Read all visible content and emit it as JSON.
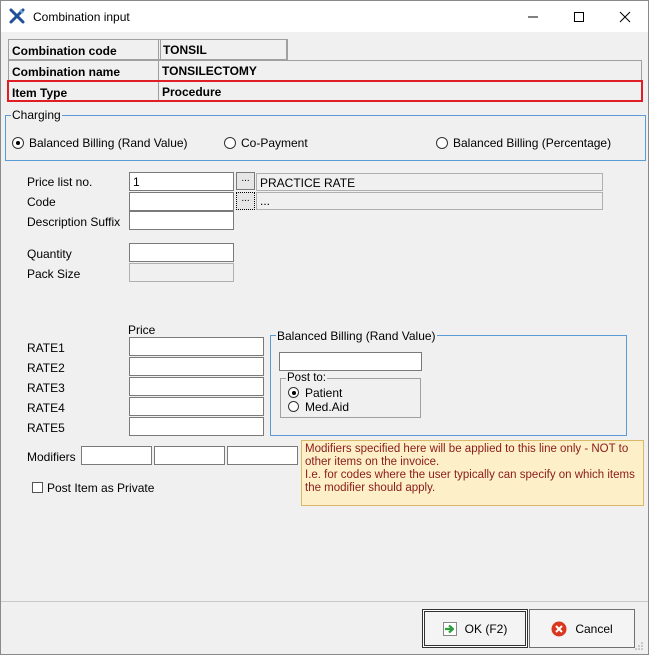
{
  "window": {
    "title": "Combination input",
    "app_icon": "tools-cross-icon",
    "controls": [
      "minimize-icon",
      "maximize-icon",
      "close-icon"
    ]
  },
  "header": {
    "rows": [
      {
        "label": "Combination code",
        "value": "TONSIL"
      },
      {
        "label": "Combination name",
        "value": "TONSILECTOMY"
      },
      {
        "label": "Item Type",
        "value": "Procedure"
      }
    ],
    "highlight_color": "#e01e26"
  },
  "charging": {
    "legend": "Charging",
    "options": [
      "Balanced Billing (Rand Value)",
      "Co-Payment",
      "Balanced Billing (Percentage)"
    ],
    "selected": "Balanced Billing (Rand Value)"
  },
  "fields": {
    "price_list_label": "Price list no.",
    "price_list_value": "1",
    "price_list_ellipsis": "...",
    "price_list_desc": "PRACTICE RATE",
    "code_label": "Code",
    "code_value": "",
    "code_ellipsis": "...",
    "code_desc": "...",
    "desc_suffix_label": "Description Suffix",
    "desc_suffix_value": "",
    "quantity_label": "Quantity",
    "quantity_value": "",
    "pack_size_label": "Pack Size",
    "pack_size_value": ""
  },
  "rates": {
    "header": "Price",
    "labels": [
      "RATE1",
      "RATE2",
      "RATE3",
      "RATE4",
      "RATE5"
    ],
    "values": [
      "",
      "",
      "",
      "",
      ""
    ]
  },
  "balanced_billing": {
    "legend": "Balanced Billing (Rand Value)",
    "value": "",
    "post_to_legend": "Post to:",
    "options": [
      "Patient",
      "Med.Aid"
    ],
    "selected": "Patient"
  },
  "modifiers": {
    "label": "Modifiers",
    "values": [
      "",
      "",
      ""
    ],
    "note": "Modifiers specified here will be applied to this line only - NOT to other items on the invoice.\nI.e. for codes where the user typically can specify on which items the modifier should apply."
  },
  "post_private": {
    "label": "Post Item as Private",
    "checked": false
  },
  "buttons": {
    "ok_label": "OK (F2)",
    "cancel_label": "Cancel",
    "ok_color": "#2e9e3e",
    "cancel_color": "#d9371f"
  }
}
